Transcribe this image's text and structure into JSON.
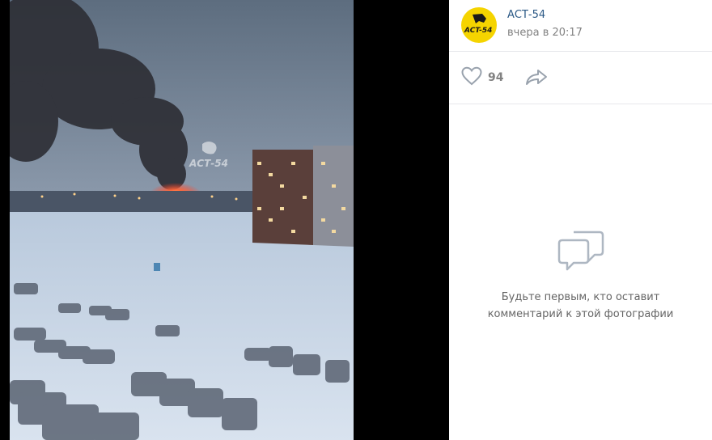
{
  "post": {
    "author": "АСТ-54",
    "time": "вчера в 20:17"
  },
  "actions": {
    "likes": "94",
    "like_icon": "heart-icon",
    "share_icon": "share-arrow-icon"
  },
  "comments": {
    "empty_icon": "comments-bubbles-icon",
    "empty_line1": "Будьте первым, кто оставит",
    "empty_line2": "комментарий к этой фотографии"
  },
  "photo": {
    "watermark": "АСТ-54"
  },
  "colors": {
    "author_link": "#2a5885",
    "muted": "#828282",
    "avatar_bg": "#f5d400"
  }
}
